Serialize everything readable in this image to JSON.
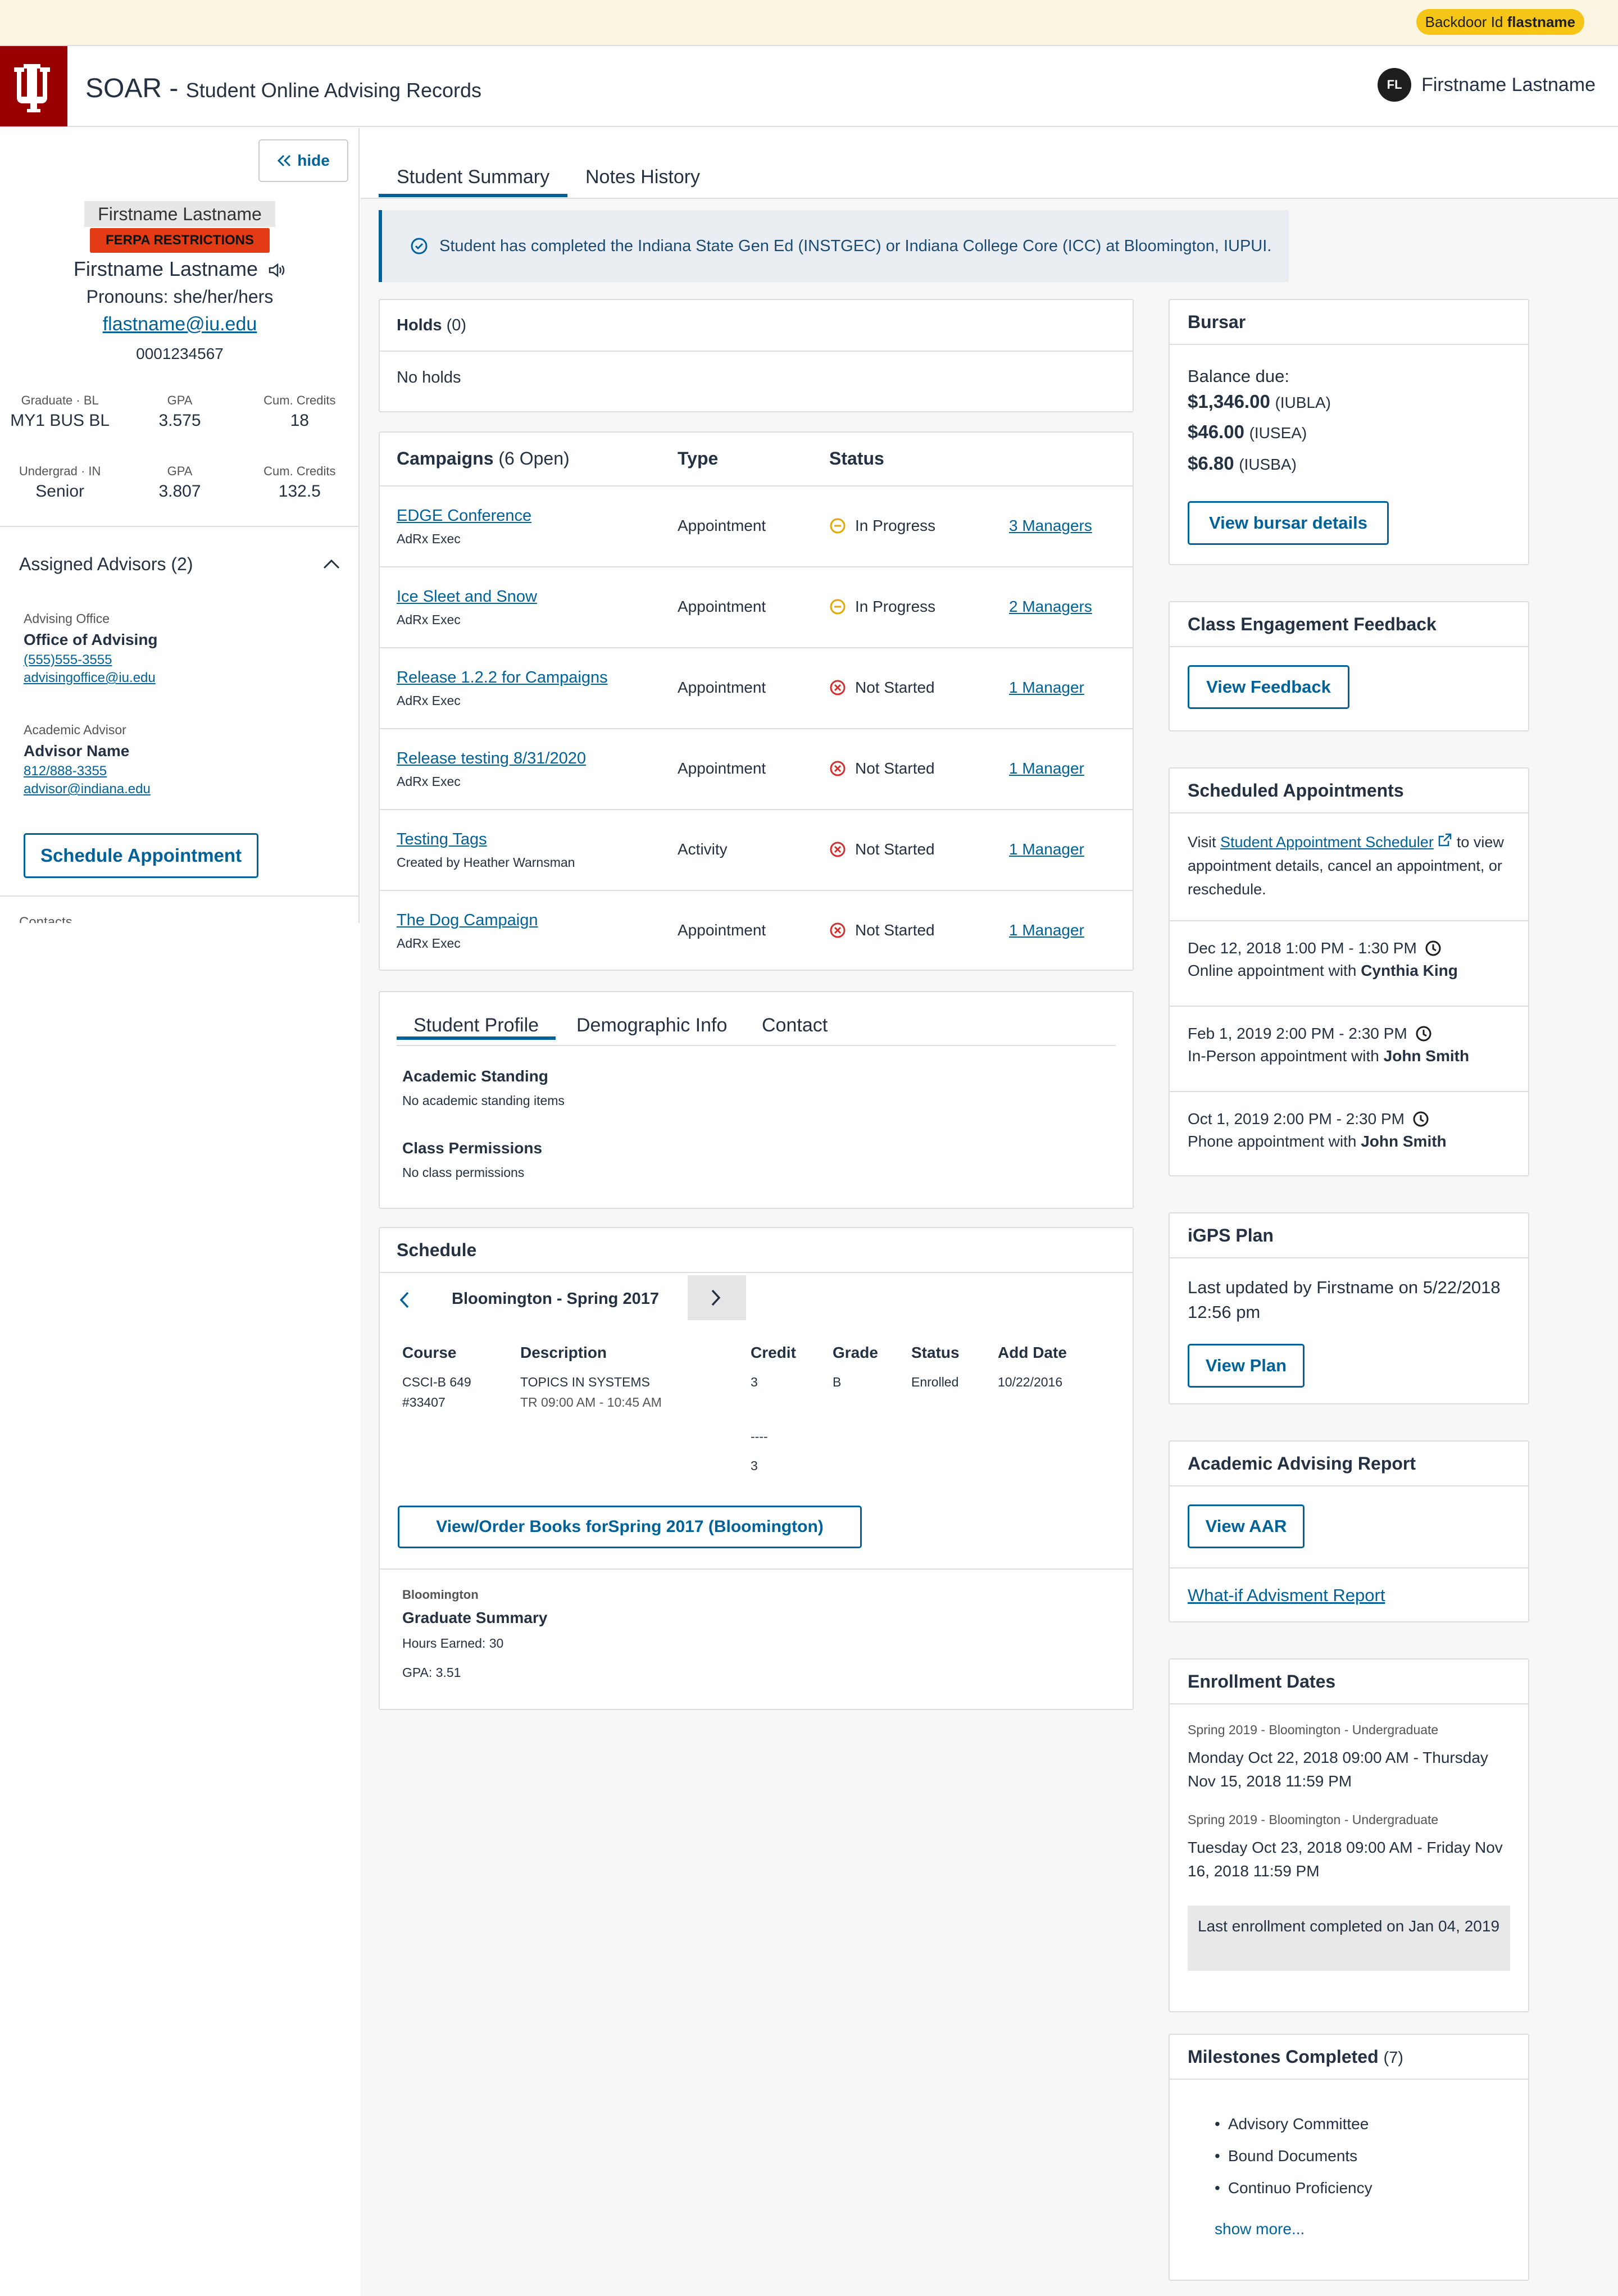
{
  "backdoor": {
    "label": "Backdoor Id",
    "user": "flastname"
  },
  "header": {
    "app": "SOAR",
    "sep": " - ",
    "subtitle": "Student Online Advising Records",
    "user_initials": "FL",
    "user_name": "Firstname Lastname"
  },
  "sidebar": {
    "hide_label": "hide",
    "photo_alt": "Firstname Lastname",
    "ferpa": "FERPA RESTRICTIONS",
    "name": "Firstname Lastname",
    "pronouns": "Pronouns: she/her/hers",
    "email": "flastname@iu.edu",
    "id": "0001234567",
    "programs": [
      {
        "career": "Graduate · BL",
        "plan": "MY1 BUS BL",
        "gpa_label": "GPA",
        "gpa": "3.575",
        "cred_label": "Cum. Credits",
        "credits": "18"
      },
      {
        "career": "Undergrad · IN",
        "plan": "Senior",
        "gpa_label": "GPA",
        "gpa": "3.807",
        "cred_label": "Cum. Credits",
        "credits": "132.5"
      }
    ],
    "advisors_title": "Assigned Advisors (2)",
    "advisors": [
      {
        "role": "Advising Office",
        "name": "Office of Advising",
        "phone": "(555)555-3555",
        "email": "advisingoffice@iu.edu"
      },
      {
        "role": "Academic Advisor",
        "name": "Advisor Name",
        "phone": "812/888-3355",
        "email": "advisor@indiana.edu"
      }
    ],
    "schedule_btn": "Schedule Appointment",
    "cut_text": "Contacts"
  },
  "tabs": [
    "Student Summary",
    "Notes History"
  ],
  "banner": "Student has completed the Indiana State Gen Ed (INSTGEC) or Indiana College Core (ICC) at Bloomington, IUPUI.",
  "holds": {
    "title": "Holds",
    "count": "(0)",
    "empty": "No holds"
  },
  "campaigns": {
    "title": "Campaigns",
    "count": "(6 Open)",
    "col_type": "Type",
    "col_status": "Status",
    "rows": [
      {
        "name": "EDGE Conference",
        "sub": "AdRx Exec",
        "type": "Appointment",
        "status": "In Progress",
        "managers": "3 Managers"
      },
      {
        "name": "Ice Sleet and Snow",
        "sub": "AdRx Exec",
        "type": "Appointment",
        "status": "In Progress",
        "managers": "2 Managers"
      },
      {
        "name": "Release 1.2.2 for Campaigns",
        "sub": "AdRx Exec",
        "type": "Appointment",
        "status": "Not Started",
        "managers": "1 Manager"
      },
      {
        "name": "Release testing 8/31/2020",
        "sub": "AdRx Exec",
        "type": "Appointment",
        "status": "Not Started",
        "managers": "1 Manager"
      },
      {
        "name": "Testing Tags",
        "sub": "Created by Heather Warnsman",
        "type": "Activity",
        "status": "Not Started",
        "managers": "1 Manager"
      },
      {
        "name": "The Dog Campaign",
        "sub": "AdRx Exec",
        "type": "Appointment",
        "status": "Not Started",
        "managers": "1 Manager"
      }
    ]
  },
  "profile": {
    "tabs": [
      "Student Profile",
      "Demographic Info",
      "Contact"
    ],
    "standing_title": "Academic Standing",
    "standing_empty": "No academic standing items",
    "perm_title": "Class Permissions",
    "perm_empty": "No class permissions"
  },
  "schedule": {
    "title": "Schedule",
    "term": "Bloomington - Spring 2017",
    "cols": [
      "Course",
      "Description",
      "Credit",
      "Grade",
      "Status",
      "Add Date"
    ],
    "course": "CSCI-B 649",
    "class_nbr": "#33407",
    "desc": "TOPICS IN SYSTEMS",
    "time": "TR 09:00 AM - 10:45 AM",
    "credit": "3",
    "grade": "B",
    "status": "Enrolled",
    "add_date": "10/22/2016",
    "dash": "----",
    "total": "3",
    "books_btn": "View/Order Books forSpring 2017 (Bloomington)",
    "campus": "Bloomington",
    "summary_title": "Graduate Summary",
    "hours": "Hours Earned: 30",
    "gpa": "GPA: 3.51"
  },
  "bursar": {
    "title": "Bursar",
    "balance_label": "Balance due:",
    "balances": [
      {
        "amount": "$1,346.00",
        "acct": "(IUBLA)"
      },
      {
        "amount": "$46.00",
        "acct": "(IUSEA)"
      },
      {
        "amount": "$6.80",
        "acct": "(IUSBA)"
      }
    ],
    "btn": "View bursar details"
  },
  "feedback": {
    "title": "Class Engagement Feedback",
    "btn": "View Feedback"
  },
  "appointments": {
    "title": "Scheduled Appointments",
    "visit": "Visit",
    "link": "Student Appointment Scheduler",
    "rest": " to view appointment details, cancel an appointment, or reschedule.",
    "items": [
      {
        "when": "Dec 12, 2018 1:00 PM - 1:30 PM",
        "desc": "Online appointment with",
        "who": "Cynthia King"
      },
      {
        "when": "Feb 1, 2019 2:00 PM - 2:30 PM",
        "desc": "In-Person appointment with",
        "who": "John Smith"
      },
      {
        "when": "Oct 1, 2019 2:00 PM - 2:30 PM",
        "desc": "Phone appointment with",
        "who": "John Smith"
      }
    ]
  },
  "igps": {
    "title": "iGPS Plan",
    "updated": "Last updated by Firstname on 5/22/2018 12:56 pm",
    "btn": "View Plan"
  },
  "aar": {
    "title": "Academic Advising Report",
    "btn": "View AAR",
    "whatif": "What-if Advisment Report"
  },
  "enrollment": {
    "title": "Enrollment Dates",
    "items": [
      {
        "term": "Spring 2019 - Bloomington - Undergraduate",
        "range": "Monday Oct 22, 2018 09:00 AM - Thursday Nov 15, 2018 11:59 PM"
      },
      {
        "term": "Spring 2019 - Bloomington - Undergraduate",
        "range": "Tuesday Oct 23, 2018 09:00 AM - Friday Nov 16, 2018 11:59 PM"
      }
    ],
    "last": "Last enrollment completed on Jan 04, 2019"
  },
  "milestones": {
    "title": "Milestones Completed",
    "count": "(7)",
    "items": [
      "Advisory Committee",
      "Bound Documents",
      "Continuo Proficiency"
    ],
    "more": "show more..."
  }
}
